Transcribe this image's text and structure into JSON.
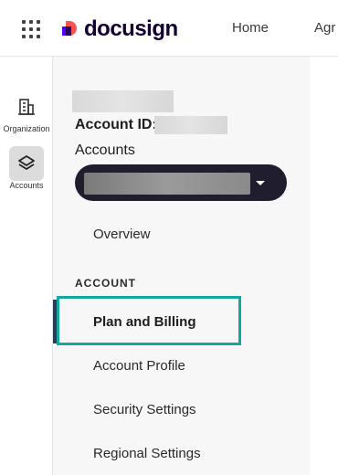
{
  "header": {
    "brand": "docusign",
    "nav": [
      {
        "label": "Home"
      },
      {
        "label": "Agr"
      }
    ]
  },
  "rail": {
    "items": [
      {
        "label": "Organization",
        "icon": "building-icon",
        "active": false
      },
      {
        "label": "Accounts",
        "icon": "layers-icon",
        "active": true
      }
    ]
  },
  "panel": {
    "account_id_label": "Account ID:",
    "accounts_label": "Accounts",
    "menu": {
      "overview": "Overview",
      "section_heading": "ACCOUNT",
      "items": [
        {
          "label": "Plan and Billing",
          "active": true
        },
        {
          "label": "Account Profile",
          "active": false
        },
        {
          "label": "Security Settings",
          "active": false
        },
        {
          "label": "Regional Settings",
          "active": false
        }
      ]
    }
  },
  "colors": {
    "highlight": "#13a89e",
    "select_bg": "#1f1d2e",
    "brand_purple": "#4c00ff",
    "brand_red": "#ff5252"
  }
}
